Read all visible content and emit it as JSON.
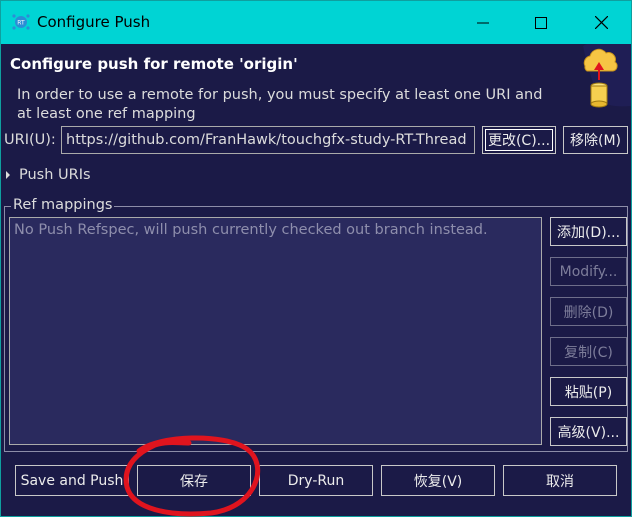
{
  "window": {
    "title": "Configure Push",
    "controls": [
      "minimize",
      "maximize",
      "close"
    ]
  },
  "header": {
    "title": "Configure push for remote 'origin'",
    "description_line1": "In order to use a remote for push, you must specify at least one URI and",
    "description_line2": "at least one ref mapping"
  },
  "uri": {
    "label": "URI(U):",
    "value": "https://github.com/FranHawk/touchgfx-study-RT-Thread",
    "change_button": "更改(C)...",
    "remove_button": "移除(M)"
  },
  "push_uris": {
    "label": "Push URIs"
  },
  "ref_mappings": {
    "group_label": "Ref mappings",
    "placeholder": "No Push Refspec, will push currently checked out branch instead.",
    "buttons": {
      "add": "添加(D)...",
      "modify": "Modify...",
      "delete": "删除(D)",
      "copy": "复制(C)",
      "paste": "粘贴(P)",
      "advanced": "高级(V)..."
    }
  },
  "footer": {
    "save_and_push": "Save and Push",
    "save": "保存",
    "dry_run": "Dry-Run",
    "revert": "恢复(V)",
    "cancel": "取消"
  },
  "colors": {
    "title_bar": "#00d4d4",
    "background": "#1b1a47",
    "annotation": "#e0141e"
  },
  "icons": {
    "app": "rt-thread-icon",
    "banner": "push-cloud-icon"
  }
}
